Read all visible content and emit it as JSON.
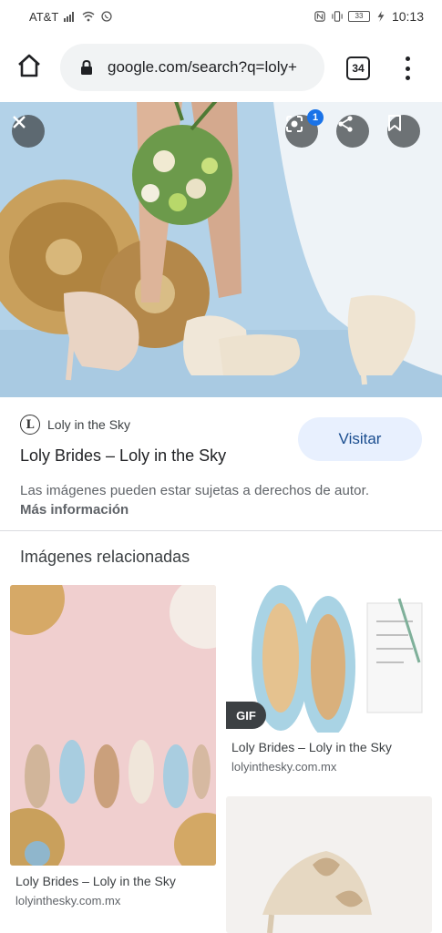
{
  "status_bar": {
    "carrier": "AT&T",
    "battery": "33",
    "time": "10:13"
  },
  "browser": {
    "url": "google.com/search?q=loly+",
    "tab_count": "34"
  },
  "viewer": {
    "lens_badge_count": "1"
  },
  "result": {
    "site_name": "Loly in the Sky",
    "site_logo_letter": "L",
    "page_title": "Loly Brides – Loly in the Sky",
    "visit_label": "Visitar",
    "copyright_notice": "Las imágenes pueden estar sujetas a derechos de autor.",
    "more_info_label": "Más información"
  },
  "related": {
    "title": "Imágenes relacionadas",
    "items": [
      {
        "title": "Loly Brides – Loly in the Sky",
        "domain": "lolyinthesky.com.mx"
      },
      {
        "title": "Loly Brides – Loly in the Sky",
        "domain": "lolyinthesky.com.mx",
        "badge": "GIF"
      },
      {
        "title": "",
        "domain": ""
      }
    ]
  },
  "icons": {
    "home": "home-icon",
    "lock": "lock-icon",
    "tabs": "tab-switcher-icon",
    "menu": "more-vert-icon",
    "close": "close-icon",
    "lens": "lens-icon",
    "share": "share-icon",
    "bookmark": "bookmark-icon"
  },
  "colors": {
    "visit_bg": "#e8f0fe",
    "badge_blue": "#1a73e8",
    "hero_sky": "#b3d2e8"
  }
}
